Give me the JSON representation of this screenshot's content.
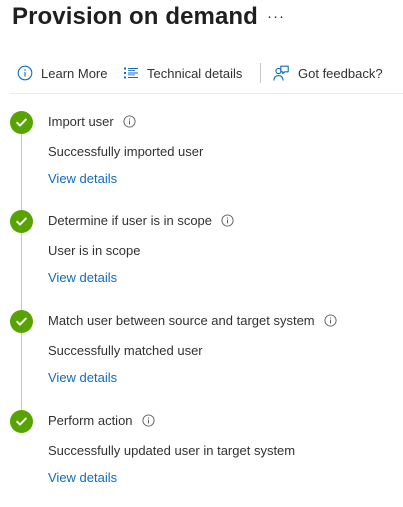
{
  "page": {
    "title": "Provision on demand",
    "more_label": "···"
  },
  "toolbar": {
    "learn_more": "Learn More",
    "technical_details": "Technical details",
    "feedback": "Got feedback?"
  },
  "steps": [
    {
      "title": "Import user",
      "status": "Successfully imported user",
      "link": "View details",
      "state": "success"
    },
    {
      "title": "Determine if user is in scope",
      "status": "User is in scope",
      "link": "View details",
      "state": "success"
    },
    {
      "title": "Match user between source and target system",
      "status": "Successfully matched user",
      "link": "View details",
      "state": "success"
    },
    {
      "title": "Perform action",
      "status": "Successfully updated user in target system",
      "link": "View details",
      "state": "success"
    }
  ],
  "colors": {
    "success": "#57a300",
    "link": "#0f6cbd",
    "icon_blue": "#0f6cbd"
  }
}
